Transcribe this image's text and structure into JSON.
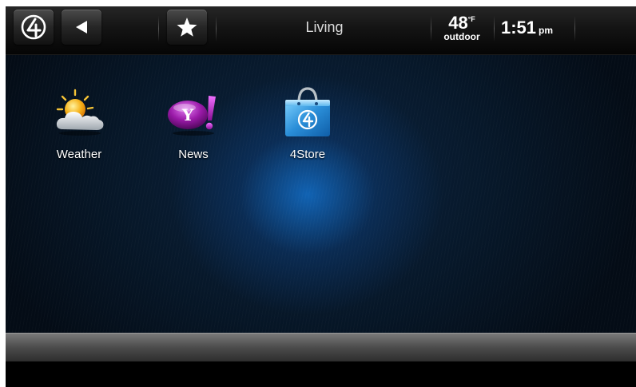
{
  "header": {
    "room_name": "Living",
    "temperature": "48",
    "temperature_unit": "°F",
    "temperature_label": "outdoor",
    "time": "1:51",
    "ampm": "pm",
    "buttons": [
      {
        "name": "control4-logo-button",
        "icon": "control4-logo-icon"
      },
      {
        "name": "back-button",
        "icon": "back-arrow-icon"
      },
      {
        "name": "favorites-button",
        "icon": "star-icon"
      }
    ]
  },
  "apps": [
    {
      "label": "Weather",
      "icon": "weather-icon"
    },
    {
      "label": "News",
      "icon": "yahoo-news-icon"
    },
    {
      "label": "4Store",
      "icon": "store-bag-icon"
    }
  ],
  "colors": {
    "glow": "#126ec8",
    "background": "#07182a",
    "bar": "#4e4e4e"
  }
}
